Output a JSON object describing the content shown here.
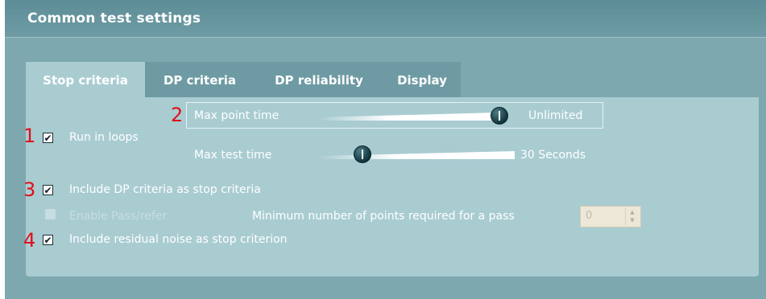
{
  "window": {
    "title": "Common test settings"
  },
  "tabs": [
    {
      "label": "Stop criteria",
      "active": true
    },
    {
      "label": "DP criteria",
      "active": false
    },
    {
      "label": "DP reliability",
      "active": false
    },
    {
      "label": "Display",
      "active": false
    }
  ],
  "markers": [
    "1",
    "2",
    "3",
    "4"
  ],
  "stop_criteria": {
    "run_in_loops": {
      "label": "Run in loops",
      "checked": true
    },
    "max_point_time": {
      "label": "Max point time",
      "value": "Unlimited",
      "slider_fraction": 1.0
    },
    "max_test_time": {
      "label": "Max test time",
      "value": "30 Seconds",
      "slider_fraction": 0.2
    },
    "include_dp_criteria": {
      "label": "Include DP criteria as stop criteria",
      "checked": true
    },
    "enable_pass_refer": {
      "label": "Enable Pass/refer",
      "checked": false,
      "enabled": false
    },
    "min_points": {
      "label": "Minimum number of points required for a pass",
      "value": "0",
      "enabled": false
    },
    "include_residual_noise": {
      "label": "Include residual noise as stop criterion",
      "checked": true
    }
  },
  "colors": {
    "panel": "#7ea8b0",
    "content": "#a9ccd1",
    "marker": "#e0101a"
  }
}
